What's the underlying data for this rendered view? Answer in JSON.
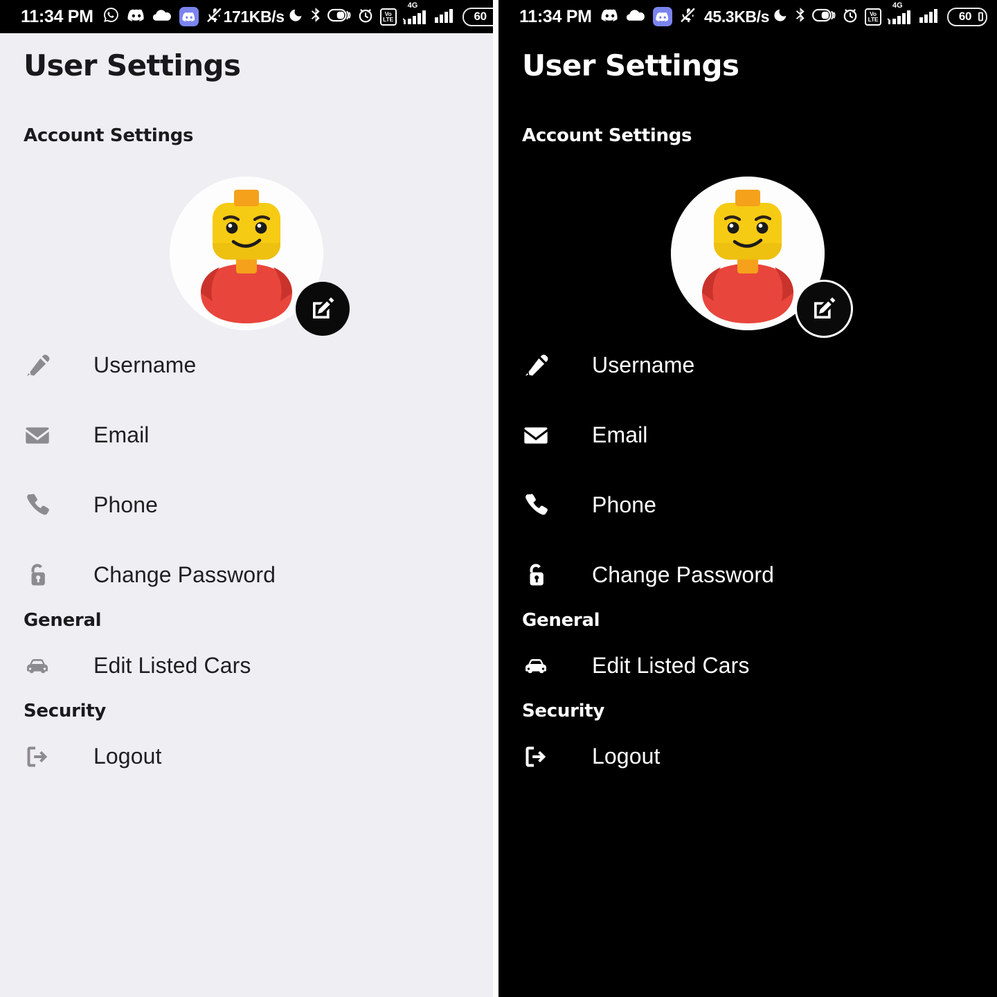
{
  "screens": [
    {
      "theme": "light",
      "theme_label": "light-theme",
      "statusbar": {
        "time": "11:34 PM",
        "net_speed": "171KB/s",
        "battery_level": "60",
        "volte_top": "Vo",
        "volte_bottom": "LTE",
        "network_gen": "4G",
        "left_icons": [
          "whatsapp-icon",
          "discord-icon",
          "cloud-icon",
          "discord-notification-badge-icon",
          "mic-muted-icon"
        ],
        "right_icons": [
          "do-not-disturb-icon",
          "bluetooth-icon",
          "dnd-toggle-icon",
          "alarm-clock-icon",
          "volte-icon",
          "signal-sim1-icon",
          "signal-sim2-icon",
          "battery-icon"
        ]
      },
      "page_title": "User Settings",
      "avatar": {
        "alt_name": "lego-minifigure-avatar",
        "edit_badge_icon": "edit-pencil-icon",
        "colors": {
          "head": "#f6cb13",
          "head_shadow": "#e9b90e",
          "neck": "#f5a11b",
          "shirt": "#e8453c",
          "shirt_shadow": "#c9332c",
          "circle_bg": "#fdfdfd"
        }
      },
      "sections": [
        {
          "heading": "Account Settings",
          "items": [
            {
              "label": "Username",
              "icon": "pen-nib-icon"
            },
            {
              "label": "Email",
              "icon": "envelope-icon"
            },
            {
              "label": "Phone",
              "icon": "phone-handset-icon"
            },
            {
              "label": "Change Password",
              "icon": "unlocked-padlock-icon"
            }
          ]
        },
        {
          "heading": "General",
          "items": [
            {
              "label": "Edit Listed Cars",
              "icon": "car-icon"
            }
          ]
        },
        {
          "heading": "Security",
          "items": [
            {
              "label": "Logout",
              "icon": "sign-out-icon"
            }
          ]
        }
      ],
      "colors": {
        "background": "#efeef3",
        "text_primary": "#1f1f21",
        "heading": "#1b1b1d",
        "icon": "#8c8c90",
        "statusbar_bg": "#000000",
        "badge_bg": "#0a0a0a"
      }
    },
    {
      "theme": "dark",
      "theme_label": "dark-theme",
      "statusbar": {
        "time": "11:34 PM",
        "net_speed": "45.3KB/s",
        "battery_level": "60",
        "volte_top": "Vo",
        "volte_bottom": "LTE",
        "network_gen": "4G",
        "left_icons": [
          "discord-icon",
          "cloud-icon",
          "discord-notification-badge-icon",
          "mic-muted-icon"
        ],
        "right_icons": [
          "do-not-disturb-icon",
          "bluetooth-icon",
          "dnd-toggle-icon",
          "alarm-clock-icon",
          "volte-icon",
          "signal-sim1-icon",
          "signal-sim2-icon",
          "battery-icon"
        ]
      },
      "page_title": "User Settings",
      "avatar": {
        "alt_name": "lego-minifigure-avatar",
        "edit_badge_icon": "edit-pencil-icon",
        "colors": {
          "head": "#f6cb13",
          "head_shadow": "#e9b90e",
          "neck": "#f5a11b",
          "shirt": "#e8453c",
          "shirt_shadow": "#c9332c",
          "circle_bg": "#fdfdfd"
        }
      },
      "sections": [
        {
          "heading": "Account Settings",
          "items": [
            {
              "label": "Username",
              "icon": "pen-nib-icon"
            },
            {
              "label": "Email",
              "icon": "envelope-icon"
            },
            {
              "label": "Phone",
              "icon": "phone-handset-icon"
            },
            {
              "label": "Change Password",
              "icon": "unlocked-padlock-icon"
            }
          ]
        },
        {
          "heading": "General",
          "items": [
            {
              "label": "Edit Listed Cars",
              "icon": "car-icon"
            }
          ]
        },
        {
          "heading": "Security",
          "items": [
            {
              "label": "Logout",
              "icon": "sign-out-icon"
            }
          ]
        }
      ],
      "colors": {
        "background": "#000000",
        "text_primary": "#ffffff",
        "heading": "#ffffff",
        "icon": "#ffffff",
        "statusbar_bg": "#000000",
        "badge_bg": "#0a0a0a"
      }
    }
  ]
}
